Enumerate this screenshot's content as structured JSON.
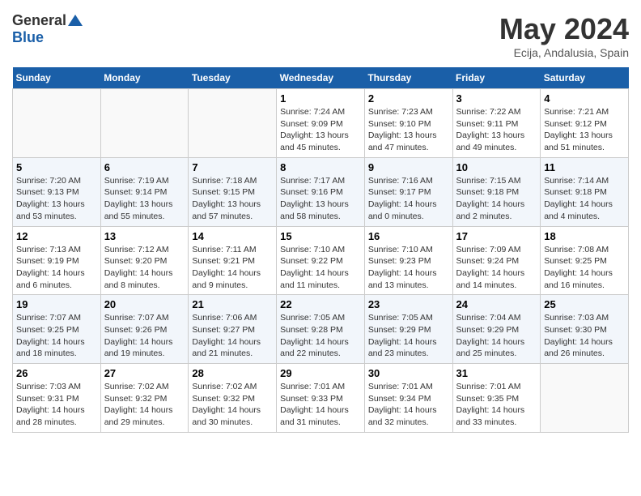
{
  "logo": {
    "general": "General",
    "blue": "Blue"
  },
  "title": "May 2024",
  "location": "Ecija, Andalusia, Spain",
  "weekdays": [
    "Sunday",
    "Monday",
    "Tuesday",
    "Wednesday",
    "Thursday",
    "Friday",
    "Saturday"
  ],
  "weeks": [
    [
      {
        "day": "",
        "sunrise": "",
        "sunset": "",
        "daylight": ""
      },
      {
        "day": "",
        "sunrise": "",
        "sunset": "",
        "daylight": ""
      },
      {
        "day": "",
        "sunrise": "",
        "sunset": "",
        "daylight": ""
      },
      {
        "day": "1",
        "sunrise": "Sunrise: 7:24 AM",
        "sunset": "Sunset: 9:09 PM",
        "daylight": "Daylight: 13 hours and 45 minutes."
      },
      {
        "day": "2",
        "sunrise": "Sunrise: 7:23 AM",
        "sunset": "Sunset: 9:10 PM",
        "daylight": "Daylight: 13 hours and 47 minutes."
      },
      {
        "day": "3",
        "sunrise": "Sunrise: 7:22 AM",
        "sunset": "Sunset: 9:11 PM",
        "daylight": "Daylight: 13 hours and 49 minutes."
      },
      {
        "day": "4",
        "sunrise": "Sunrise: 7:21 AM",
        "sunset": "Sunset: 9:12 PM",
        "daylight": "Daylight: 13 hours and 51 minutes."
      }
    ],
    [
      {
        "day": "5",
        "sunrise": "Sunrise: 7:20 AM",
        "sunset": "Sunset: 9:13 PM",
        "daylight": "Daylight: 13 hours and 53 minutes."
      },
      {
        "day": "6",
        "sunrise": "Sunrise: 7:19 AM",
        "sunset": "Sunset: 9:14 PM",
        "daylight": "Daylight: 13 hours and 55 minutes."
      },
      {
        "day": "7",
        "sunrise": "Sunrise: 7:18 AM",
        "sunset": "Sunset: 9:15 PM",
        "daylight": "Daylight: 13 hours and 57 minutes."
      },
      {
        "day": "8",
        "sunrise": "Sunrise: 7:17 AM",
        "sunset": "Sunset: 9:16 PM",
        "daylight": "Daylight: 13 hours and 58 minutes."
      },
      {
        "day": "9",
        "sunrise": "Sunrise: 7:16 AM",
        "sunset": "Sunset: 9:17 PM",
        "daylight": "Daylight: 14 hours and 0 minutes."
      },
      {
        "day": "10",
        "sunrise": "Sunrise: 7:15 AM",
        "sunset": "Sunset: 9:18 PM",
        "daylight": "Daylight: 14 hours and 2 minutes."
      },
      {
        "day": "11",
        "sunrise": "Sunrise: 7:14 AM",
        "sunset": "Sunset: 9:18 PM",
        "daylight": "Daylight: 14 hours and 4 minutes."
      }
    ],
    [
      {
        "day": "12",
        "sunrise": "Sunrise: 7:13 AM",
        "sunset": "Sunset: 9:19 PM",
        "daylight": "Daylight: 14 hours and 6 minutes."
      },
      {
        "day": "13",
        "sunrise": "Sunrise: 7:12 AM",
        "sunset": "Sunset: 9:20 PM",
        "daylight": "Daylight: 14 hours and 8 minutes."
      },
      {
        "day": "14",
        "sunrise": "Sunrise: 7:11 AM",
        "sunset": "Sunset: 9:21 PM",
        "daylight": "Daylight: 14 hours and 9 minutes."
      },
      {
        "day": "15",
        "sunrise": "Sunrise: 7:10 AM",
        "sunset": "Sunset: 9:22 PM",
        "daylight": "Daylight: 14 hours and 11 minutes."
      },
      {
        "day": "16",
        "sunrise": "Sunrise: 7:10 AM",
        "sunset": "Sunset: 9:23 PM",
        "daylight": "Daylight: 14 hours and 13 minutes."
      },
      {
        "day": "17",
        "sunrise": "Sunrise: 7:09 AM",
        "sunset": "Sunset: 9:24 PM",
        "daylight": "Daylight: 14 hours and 14 minutes."
      },
      {
        "day": "18",
        "sunrise": "Sunrise: 7:08 AM",
        "sunset": "Sunset: 9:25 PM",
        "daylight": "Daylight: 14 hours and 16 minutes."
      }
    ],
    [
      {
        "day": "19",
        "sunrise": "Sunrise: 7:07 AM",
        "sunset": "Sunset: 9:25 PM",
        "daylight": "Daylight: 14 hours and 18 minutes."
      },
      {
        "day": "20",
        "sunrise": "Sunrise: 7:07 AM",
        "sunset": "Sunset: 9:26 PM",
        "daylight": "Daylight: 14 hours and 19 minutes."
      },
      {
        "day": "21",
        "sunrise": "Sunrise: 7:06 AM",
        "sunset": "Sunset: 9:27 PM",
        "daylight": "Daylight: 14 hours and 21 minutes."
      },
      {
        "day": "22",
        "sunrise": "Sunrise: 7:05 AM",
        "sunset": "Sunset: 9:28 PM",
        "daylight": "Daylight: 14 hours and 22 minutes."
      },
      {
        "day": "23",
        "sunrise": "Sunrise: 7:05 AM",
        "sunset": "Sunset: 9:29 PM",
        "daylight": "Daylight: 14 hours and 23 minutes."
      },
      {
        "day": "24",
        "sunrise": "Sunrise: 7:04 AM",
        "sunset": "Sunset: 9:29 PM",
        "daylight": "Daylight: 14 hours and 25 minutes."
      },
      {
        "day": "25",
        "sunrise": "Sunrise: 7:03 AM",
        "sunset": "Sunset: 9:30 PM",
        "daylight": "Daylight: 14 hours and 26 minutes."
      }
    ],
    [
      {
        "day": "26",
        "sunrise": "Sunrise: 7:03 AM",
        "sunset": "Sunset: 9:31 PM",
        "daylight": "Daylight: 14 hours and 28 minutes."
      },
      {
        "day": "27",
        "sunrise": "Sunrise: 7:02 AM",
        "sunset": "Sunset: 9:32 PM",
        "daylight": "Daylight: 14 hours and 29 minutes."
      },
      {
        "day": "28",
        "sunrise": "Sunrise: 7:02 AM",
        "sunset": "Sunset: 9:32 PM",
        "daylight": "Daylight: 14 hours and 30 minutes."
      },
      {
        "day": "29",
        "sunrise": "Sunrise: 7:01 AM",
        "sunset": "Sunset: 9:33 PM",
        "daylight": "Daylight: 14 hours and 31 minutes."
      },
      {
        "day": "30",
        "sunrise": "Sunrise: 7:01 AM",
        "sunset": "Sunset: 9:34 PM",
        "daylight": "Daylight: 14 hours and 32 minutes."
      },
      {
        "day": "31",
        "sunrise": "Sunrise: 7:01 AM",
        "sunset": "Sunset: 9:35 PM",
        "daylight": "Daylight: 14 hours and 33 minutes."
      },
      {
        "day": "",
        "sunrise": "",
        "sunset": "",
        "daylight": ""
      }
    ]
  ]
}
